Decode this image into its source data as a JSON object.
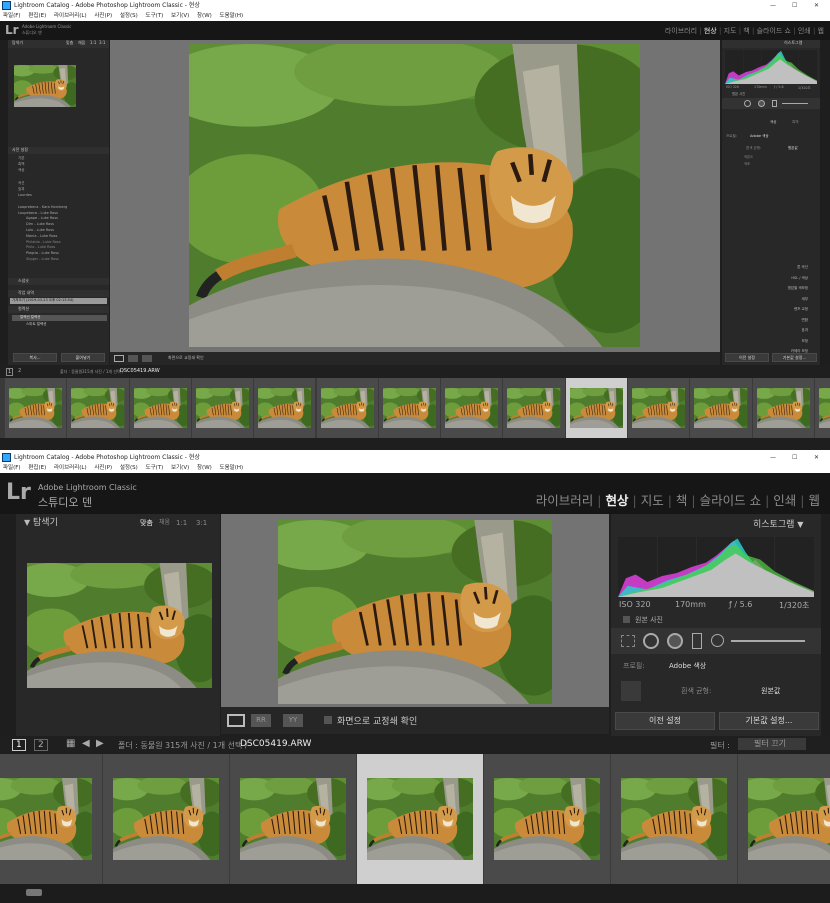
{
  "window": {
    "title": "Lightroom Catalog - Adobe Photoshop Lightroom Classic - 현상",
    "minimize": "—",
    "maximize": "☐",
    "close": "✕"
  },
  "menu": [
    "파일(F)",
    "편집(E)",
    "라이브러리(L)",
    "사진(P)",
    "설정(S)",
    "도구(T)",
    "보기(V)",
    "창(W)",
    "도움말(H)"
  ],
  "branding": {
    "logo": "Lr",
    "product": "Adobe Lightroom Classic",
    "studio": "스튜디오 덴"
  },
  "modules": [
    "라이브러리",
    "현상",
    "지도",
    "책",
    "슬라이드 쇼",
    "인쇄",
    "웹"
  ],
  "active_module": "현상",
  "navigator": {
    "title": "탐색기",
    "zoom": [
      "맞춤",
      "채움",
      "1:1",
      "3:1"
    ]
  },
  "left_panels": {
    "presets_title": "사전 설정",
    "preset_items": [
      "기본",
      "흑백",
      "색상",
      "곡선",
      "효과",
      "Lourdes",
      "Looprebeca - Kara Hornberg",
      "Loupebeca - Luke Ross"
    ],
    "subitems": [
      "Agape - Luke Ross",
      "Dim - Luke Ross",
      "Lolo - Luke Ross",
      "Mania - Luke Ross",
      "Philaida - Luke Ross",
      "Philo - Luke Ross",
      "Plegria - Luke Ross",
      "Skyger - Luke Ross"
    ],
    "snapshots_title": "스냅숏",
    "history_title": "작업 내역",
    "history_item": "가져오기 (2019-03-23 오후 02:13:54)",
    "collections_title": "컬렉션",
    "collection_items": [
      "컬렉션 컬렉션",
      "스마트 컬렉션"
    ],
    "copy_button": "복사...",
    "paste_button": "붙여넣기"
  },
  "toolbar": {
    "softproof_label": "화면으로 교정쇄 확인"
  },
  "histogram": {
    "title": "히스토그램",
    "iso": "ISO 320",
    "focal": "170mm",
    "aperture": "ƒ / 5.6",
    "shutter": "1/320초",
    "original": "원본 사진"
  },
  "basic": {
    "treatment_color": "색상",
    "treatment_bw": "흑백",
    "profile_label": "프로필:",
    "profile_value": "Adobe 색상",
    "wb_label": "흰색 균형:",
    "wb_value": "원본값",
    "temp_label": "색온도",
    "tint_label": "색조"
  },
  "right_sections": [
    "톤 곡선",
    "HSL / 색상",
    "명암별 색보정",
    "세부",
    "렌즈 교정",
    "변환",
    "효과",
    "보정",
    "카메라 보정"
  ],
  "right_buttons": {
    "previous": "이전 설정",
    "reset": "기본값 설정..."
  },
  "filmbar": {
    "page1": "1",
    "page2": "2",
    "source": "폴더 : 동물원",
    "count": "315개 사진 / 1개 선택 /",
    "filename": "DSC05419.ARW",
    "filter_label": "필터 :",
    "filter_value": "필터 끄기"
  },
  "colors": {
    "accent": "#f0f0f0",
    "panel_bg": "#282828",
    "center_bg": "#737373",
    "selected_cell": "#cfcfcf"
  }
}
